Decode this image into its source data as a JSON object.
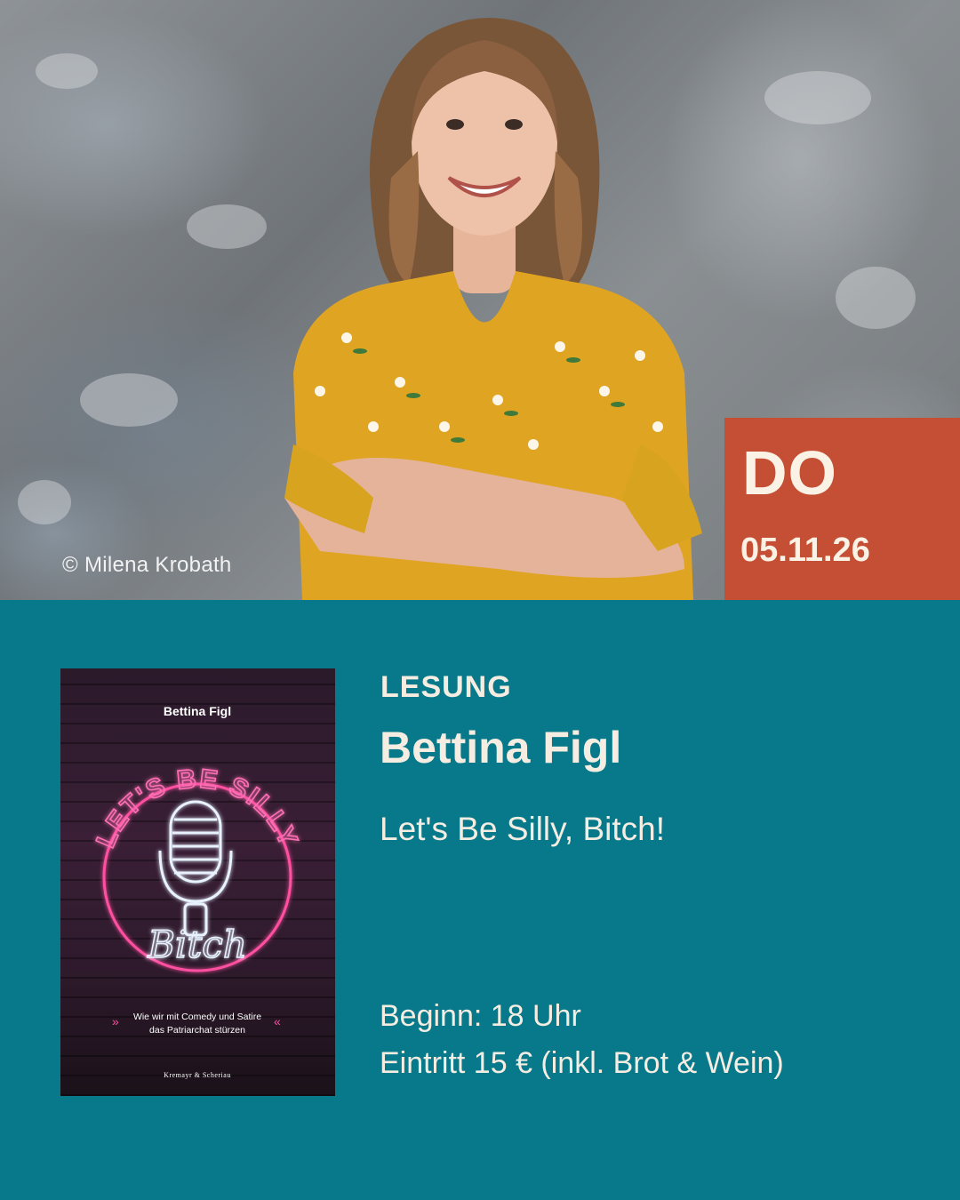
{
  "photo": {
    "credit": "© Milena Krobath"
  },
  "date": {
    "day": "DO",
    "date": "05.11.26"
  },
  "book": {
    "author": "Bettina Figl",
    "title_neon": "LET'S BE SILLY",
    "title_script": "Bitch",
    "tagline_line1": "Wie wir mit Comedy und Satire",
    "tagline_line2": "das Patriarchat stürzen",
    "publisher": "Kremayr & Scheriau"
  },
  "event": {
    "category": "LESUNG",
    "author": "Bettina Figl",
    "title": "Let's Be Silly, Bitch!",
    "start": "Beginn: 18 Uhr",
    "admission": "Eintritt 15 € (inkl. Brot & Wein)"
  },
  "colors": {
    "teal": "#07798a",
    "date_box": "#c44f34",
    "text_light": "#f5ede1",
    "neon_pink": "#ff4fa0"
  }
}
